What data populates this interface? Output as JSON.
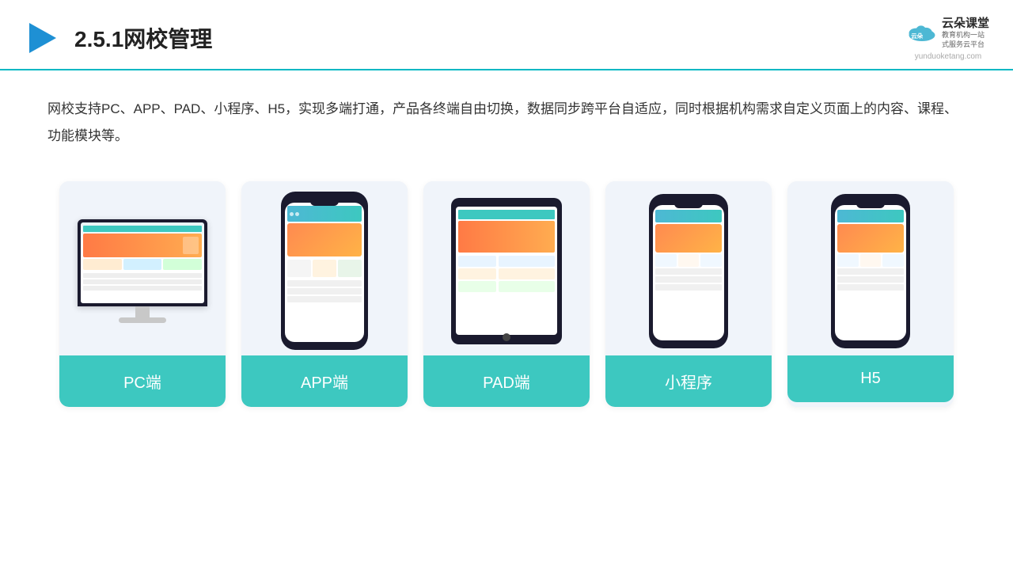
{
  "header": {
    "title": "2.5.1网校管理",
    "logo_main": "云朵课堂",
    "logo_tagline": "教育机构一站\n式服务云平台",
    "logo_url": "yunduoketang.com"
  },
  "description": {
    "text": "网校支持PC、APP、PAD、小程序、H5，实现多端打通，产品各终端自由切换，数据同步跨平台自适应，同时根据机构需求自定义页面上的内容、课程、功能模块等。"
  },
  "cards": [
    {
      "id": "pc",
      "label": "PC端"
    },
    {
      "id": "app",
      "label": "APP端"
    },
    {
      "id": "pad",
      "label": "PAD端"
    },
    {
      "id": "miniprogram",
      "label": "小程序"
    },
    {
      "id": "h5",
      "label": "H5"
    }
  ]
}
